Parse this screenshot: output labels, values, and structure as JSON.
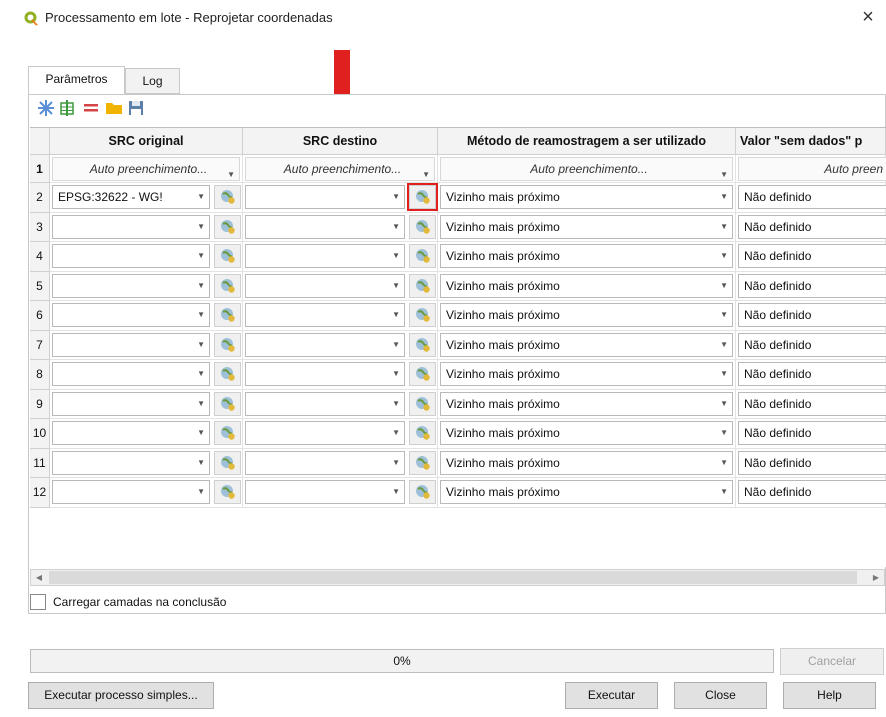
{
  "window": {
    "title": "Processamento em lote - Reprojetar coordenadas",
    "close_glyph": "×"
  },
  "tabs": [
    {
      "label": "Parâmetros",
      "active": true
    },
    {
      "label": "Log",
      "active": false
    }
  ],
  "toolbar": {
    "buttons": [
      "autofill-icon",
      "add-row-icon",
      "remove-row-icon",
      "open-file-icon",
      "save-icon"
    ]
  },
  "table": {
    "columns": [
      "SRC original",
      "SRC destino",
      "Método de reamostragem a ser utilizado",
      "Valor \"sem dados\" p"
    ],
    "autofill_row": {
      "row_number": "1",
      "src_original": "Auto preenchimento...",
      "src_destino": "Auto preenchimento...",
      "metodo": "Auto preenchimento...",
      "valor": "Auto preen"
    },
    "rows": [
      {
        "n": "2",
        "src_original": "EPSG:32622 - WG!",
        "src_destino": "",
        "metodo": "Vizinho mais próximo",
        "valor": "Não definido"
      },
      {
        "n": "3",
        "src_original": "",
        "src_destino": "",
        "metodo": "Vizinho mais próximo",
        "valor": "Não definido"
      },
      {
        "n": "4",
        "src_original": "",
        "src_destino": "",
        "metodo": "Vizinho mais próximo",
        "valor": "Não definido"
      },
      {
        "n": "5",
        "src_original": "",
        "src_destino": "",
        "metodo": "Vizinho mais próximo",
        "valor": "Não definido"
      },
      {
        "n": "6",
        "src_original": "",
        "src_destino": "",
        "metodo": "Vizinho mais próximo",
        "valor": "Não definido"
      },
      {
        "n": "7",
        "src_original": "",
        "src_destino": "",
        "metodo": "Vizinho mais próximo",
        "valor": "Não definido"
      },
      {
        "n": "8",
        "src_original": "",
        "src_destino": "",
        "metodo": "Vizinho mais próximo",
        "valor": "Não definido"
      },
      {
        "n": "9",
        "src_original": "",
        "src_destino": "",
        "metodo": "Vizinho mais próximo",
        "valor": "Não definido"
      },
      {
        "n": "10",
        "src_original": "",
        "src_destino": "",
        "metodo": "Vizinho mais próximo",
        "valor": "Não definido"
      },
      {
        "n": "11",
        "src_original": "",
        "src_destino": "",
        "metodo": "Vizinho mais próximo",
        "valor": "Não definido"
      },
      {
        "n": "12",
        "src_original": "",
        "src_destino": "",
        "metodo": "Vizinho mais próximo",
        "valor": "Não definido"
      }
    ]
  },
  "load_layers_checkbox": {
    "label": "Carregar camadas na conclusão",
    "checked": false
  },
  "progress": {
    "text": "0%",
    "value": 0
  },
  "buttons": {
    "cancel": "Cancelar",
    "run_single": "Executar processo simples...",
    "run": "Executar",
    "close": "Close",
    "help": "Help"
  },
  "colors": {
    "highlight": "#e01f1f",
    "arrow": "#e01f1f"
  }
}
